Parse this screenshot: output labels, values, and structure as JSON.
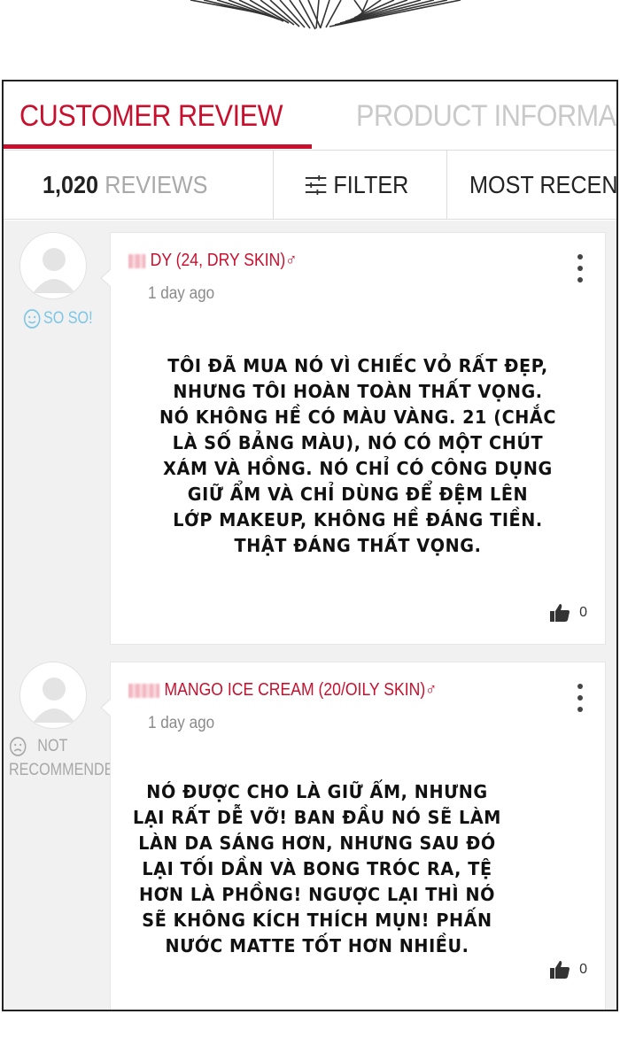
{
  "tabs": [
    {
      "label": "CUSTOMER REVIEW",
      "active": true
    },
    {
      "label": "PRODUCT INFORMA",
      "active": false
    }
  ],
  "toolbar": {
    "count_value": "1,020",
    "count_label": "REVIEWS",
    "filter_label": "FILTER",
    "sort_label": "MOST RECENT"
  },
  "reviews": [
    {
      "reviewer": "DY (24, DRY SKIN)",
      "gender_symbol": "♂",
      "date": "1 day ago",
      "rating": "SO SO!",
      "rating_icon": "neutral-face-icon",
      "text": "TÔI ĐÃ MUA NÓ VÌ CHIẾC VỎ RẤT ĐẸP, NHƯNG TÔI HOÀN TOÀN THẤT VỌNG. NÓ KHÔNG HỀ CÓ MÀU VÀNG. 21 (CHẮC LÀ SỐ BẢNG MÀU), NÓ CÓ MỘT CHÚT XÁM VÀ HỒNG. NÓ CHỈ CÓ CÔNG DỤNG GIỮ ẨM VÀ CHỈ DÙNG ĐỂ ĐỆM LÊN LỚP MAKEUP, KHÔNG HỀ ĐÁNG TIỀN. THẬT ĐÁNG THẤT VỌNG.",
      "lines": [
        "TÔI ĐÃ MUA NÓ VÌ CHIẾC VỎ RẤT ĐẸP,",
        "NHƯNG TÔI HOÀN TOÀN THẤT VỌNG.",
        "NÓ KHÔNG HỀ CÓ MÀU VÀNG. 21 (CHẮC",
        "LÀ SỐ BẢNG MÀU), NÓ CÓ MỘT CHÚT",
        "XÁM VÀ HỒNG. NÓ CHỈ CÓ CÔNG DỤNG",
        "GIỮ ẨM VÀ CHỈ DÙNG ĐỂ ĐỆM LÊN",
        "LỚP MAKEUP, KHÔNG HỀ ĐÁNG TIỀN.",
        "THẬT ĐÁNG THẤT VỌNG."
      ],
      "likes": "0"
    },
    {
      "reviewer": "MANGO ICE CREAM (20/OILY SKIN)",
      "gender_symbol": "♂",
      "date": "1 day ago",
      "rating_line1": "NOT",
      "rating_line2": "RECOMMENDED!",
      "rating_icon": "sad-face-icon",
      "lines": [
        "NÓ ĐƯỢC CHO LÀ GIỮ ẨM, NHƯNG",
        "LẠI RẤT DỄ VỠ! BAN ĐẦU NÓ SẼ LÀM",
        "LÀN DA SÁNG HƠN, NHƯNG SAU ĐÓ",
        "LẠI TỐI DẦN VÀ BONG TRÓC RA, TỆ",
        "HƠN LÀ PHỒNG! NGƯỢC LẠI THÌ NÓ",
        "SẼ KHÔNG KÍCH THÍCH MỤN! PHẤN",
        "NƯỚC MATTE TỐT HƠN NHIỀU."
      ],
      "likes": "0"
    }
  ],
  "colors": {
    "accent": "#c8102e",
    "inactive_tab": "#c9c9c9",
    "rating_positive": "#7cc6e6",
    "rating_negative": "#a8a8a8",
    "list_background": "#f1f1f1"
  }
}
